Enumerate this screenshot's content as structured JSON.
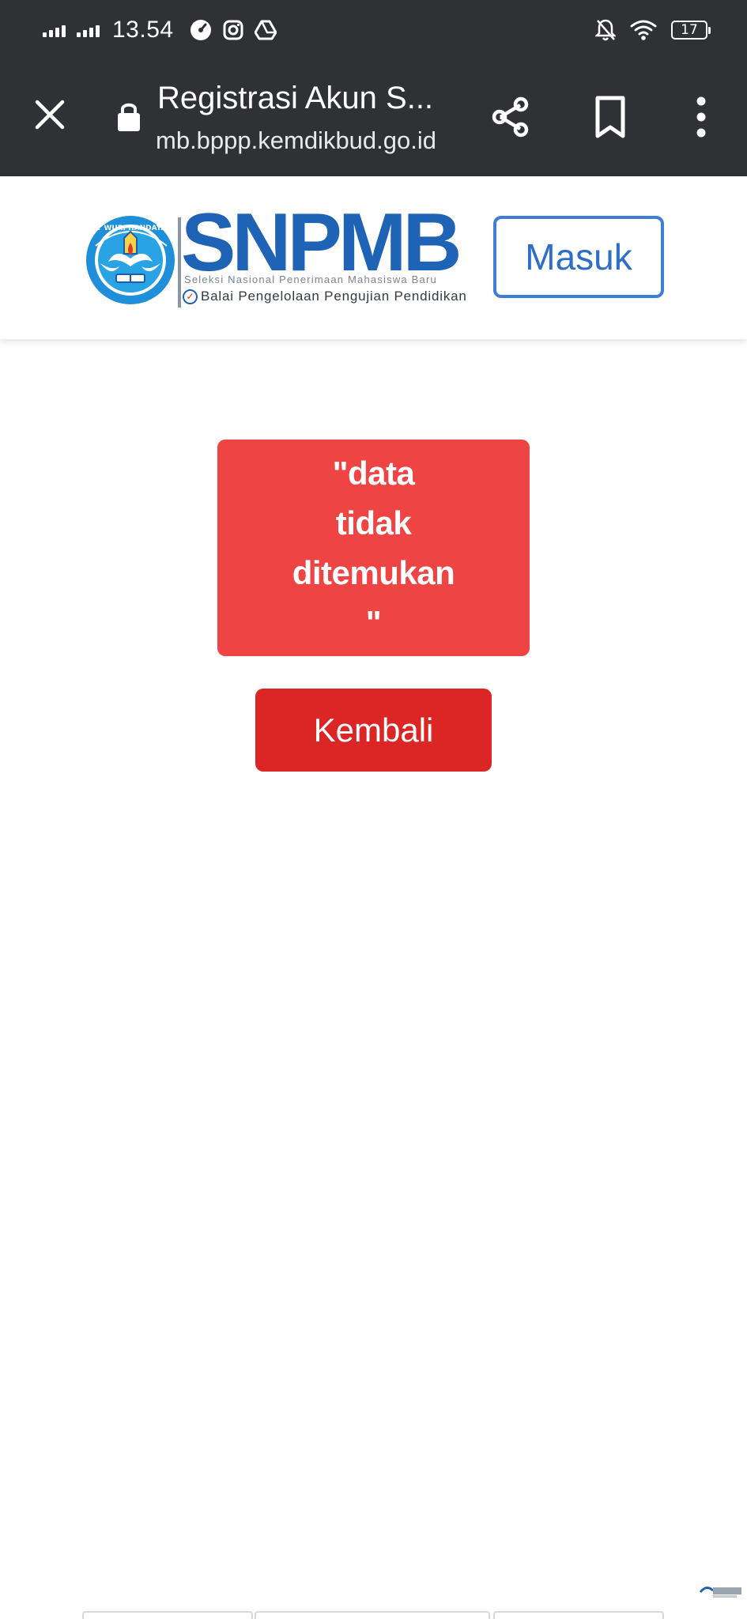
{
  "status_bar": {
    "time": "13.54",
    "battery": "17",
    "icons": [
      "signal-icon",
      "signal-icon",
      "speedometer-icon",
      "instagram-icon",
      "drive-icon",
      "notifications-off-icon",
      "wifi-icon",
      "battery-icon"
    ]
  },
  "toolbar": {
    "title": "Registrasi Akun S...",
    "url": "mb.bppp.kemdikbud.go.id",
    "close_icon": "close-icon",
    "lock_icon": "lock-icon",
    "share_icon": "share-icon",
    "bookmark_icon": "bookmark-icon",
    "menu_icon": "more-vert-icon"
  },
  "header": {
    "logo_text": "SNPMB",
    "logo_subtitle": "Seleksi Nasional Penerimaan Mahasiswa Baru",
    "logo_org": "Balai Pengelolaan Pengujian Pendidikan",
    "emblem_text": "TUT WURI HANDAYANI",
    "login_label": "Masuk"
  },
  "main": {
    "message": "\"data tidak ditemukan\"",
    "back_label": "Kembali"
  },
  "colors": {
    "chrome_bg": "#303134",
    "brand_blue": "#1e63b5",
    "login_border": "#3e7ed5",
    "alert_bg": "#ef4444",
    "button_bg": "#dc2626"
  }
}
